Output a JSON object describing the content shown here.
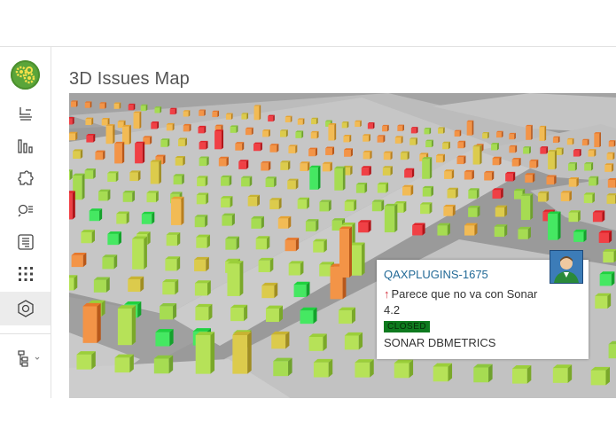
{
  "page": {
    "title": "3D Issues Map"
  },
  "sidebar": {
    "items": [
      {
        "name": "sidebar-item-projects",
        "icon": "project-stack-icon"
      },
      {
        "name": "sidebar-item-measures",
        "icon": "bar-chart-icon"
      },
      {
        "name": "sidebar-item-plugins",
        "icon": "puzzle-icon"
      },
      {
        "name": "sidebar-item-issues",
        "icon": "search-list-icon"
      },
      {
        "name": "sidebar-item-reports",
        "icon": "document-icon"
      },
      {
        "name": "sidebar-item-apps",
        "icon": "grid-icon"
      },
      {
        "name": "sidebar-item-3d-map",
        "icon": "hexagon-icon",
        "active": true
      },
      {
        "name": "sidebar-item-hierarchy",
        "icon": "hierarchy-icon"
      }
    ]
  },
  "issue_popup": {
    "key": "QAXPLUGINS-1675",
    "priority_icon": "arrow-up-icon",
    "summary": "Parece que no va con Sonar",
    "version": "4.2",
    "status": "CLOSED",
    "component": "SONAR DBMETRICS"
  },
  "colors": {
    "accent_link": "#236a97",
    "status_closed": "#0e7a1e",
    "logo_green": "#5aa53a"
  }
}
